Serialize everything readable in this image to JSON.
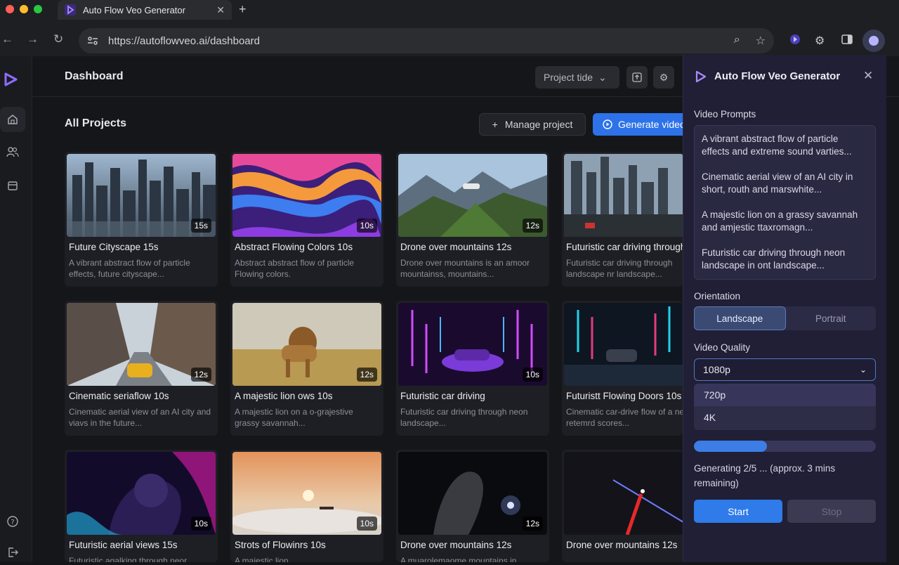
{
  "browser": {
    "tab_title": "Auto Flow Veo Generator",
    "tab_close": "✕",
    "new_tab": "+",
    "url": "https://autoflowveo.ai/dashboard"
  },
  "app": {
    "header_title": "Dashboard",
    "project_select": "Project tide",
    "section_title": "All Projects",
    "manage_label": "Manage project",
    "generate_label": "Generate video"
  },
  "projects": [
    {
      "name": "Future Cityscape 15s",
      "duration": "15s",
      "desc": "A vibrant abstract flow of particle effects, future cityscape..."
    },
    {
      "name": "Abstract Flowing Colors 10s",
      "duration": "10s",
      "desc": "Abstract abstract flow of particle Flowing colors."
    },
    {
      "name": "Drone over mountains 12s",
      "duration": "12s",
      "desc": "Drone over mountains is an amoor mountainss, mountains..."
    },
    {
      "name": "Futuristic car driving through",
      "duration": "",
      "desc": "Futuristic car driving through landscape nr landscape..."
    },
    {
      "name": "Cinematic seriaflow 10s",
      "duration": "12s",
      "desc": "Cinematic aerial view of an AI city and viavs in the future..."
    },
    {
      "name": "A majestic lion ows 10s",
      "duration": "12s",
      "desc": "A majestic lion on a o-grajestive grassy savannah..."
    },
    {
      "name": "Futuristic car driving",
      "duration": "10s",
      "desc": "Futuristic car driving through neon landscape..."
    },
    {
      "name": "Futuristt Flowing Doors 10s",
      "duration": "",
      "desc": "Cinematic car-drive flow of a neori-retemrd scores..."
    },
    {
      "name": "Futuristic aerial views 15s",
      "duration": "10s",
      "desc": "Futuristic agalking through neor"
    },
    {
      "name": "Strots of Flowinrs 10s",
      "duration": "10s",
      "desc": "A majestic lion"
    },
    {
      "name": "Drone over mountains 12s",
      "duration": "12s",
      "desc": "A muarolemaome mountains in"
    },
    {
      "name": "Drone over mountains 12s",
      "duration": "",
      "desc": ""
    }
  ],
  "panel": {
    "title": "Auto Flow Veo Generator",
    "prompts_label": "Video Prompts",
    "prompts": [
      "A vibrant abstract flow of particle effects and extreme sound varties...",
      "Cinematic aerial view of an AI city in short, routh and marswhite...",
      "A majestic lion on a grassy savannah and amjestic ttaxromagn...",
      "Futuristic car driving through neon landscape in ont landscape..."
    ],
    "orientation_label": "Orientation",
    "orientation_options": [
      "Landscape",
      "Portrait"
    ],
    "orientation_selected": "Landscape",
    "quality_label": "Video Quality",
    "quality_selected": "1080p",
    "quality_options": [
      "720p",
      "4K"
    ],
    "progress": 0.4,
    "status": "Generating 2/5 ... (approx. 3 mins remaining)",
    "start_label": "Start",
    "stop_label": "Stop"
  },
  "colors": {
    "accent": "#2d72e8",
    "panel_bg": "#201f35",
    "logo": "#8f6bff"
  },
  "icons": {
    "back": "←",
    "forward": "→",
    "reload": "↻",
    "zoom": "⌕",
    "star": "☆",
    "chevron": "⌄",
    "settings": "⚙"
  }
}
